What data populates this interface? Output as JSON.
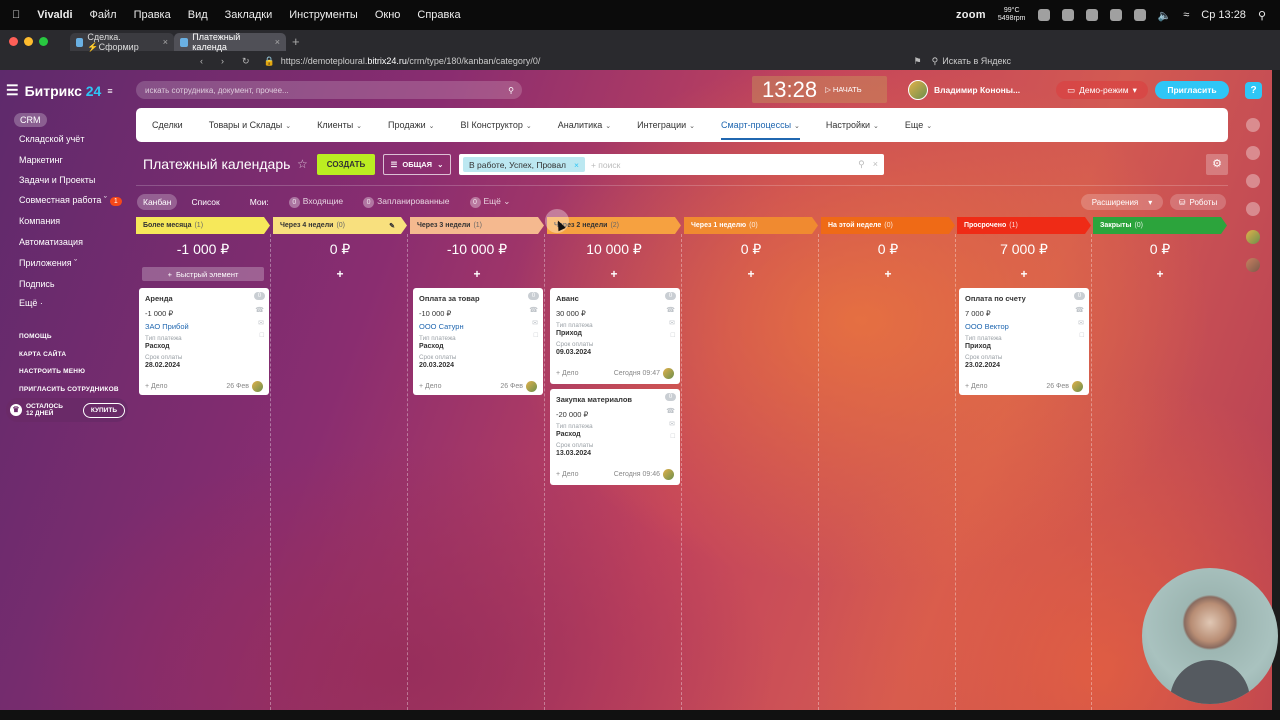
{
  "macos": {
    "app": "Vivaldi",
    "menu": [
      "Файл",
      "Правка",
      "Вид",
      "Закладки",
      "Инструменты",
      "Окно",
      "Справка"
    ],
    "zoom": "zoom",
    "temp": "99°C",
    "rpm": "5498rpm",
    "clock": "Ср 13:28"
  },
  "browser": {
    "tabs": [
      {
        "title": "Сделка. ⚡Сформир"
      },
      {
        "title": "Платежный календа"
      }
    ],
    "url_prefix": "https://demoteploural.",
    "url_domain": "bitrix24.ru",
    "url_path": "/crm/type/180/kanban/category/0/",
    "search_placeholder": "Искать в Яндекс"
  },
  "sidebar": {
    "logo_text": "Битрикс",
    "logo_num": "24",
    "items": [
      {
        "label": "CRM"
      },
      {
        "label": "Складской учёт"
      },
      {
        "label": "Маркетинг"
      },
      {
        "label": "Задачи и Проекты"
      },
      {
        "label": "Совместная работа",
        "badge": "1"
      },
      {
        "label": "Компания"
      },
      {
        "label": "Автоматизация"
      },
      {
        "label": "Приложения"
      },
      {
        "label": "Подпись"
      },
      {
        "label": "Ещё ·"
      }
    ],
    "links": [
      "ПОМОЩЬ",
      "КАРТА САЙТА",
      "НАСТРОИТЬ МЕНЮ",
      "ПРИГЛАСИТЬ СОТРУДНИКОВ"
    ],
    "trial_line1": "ОСТАЛОСЬ",
    "trial_line2": "12 ДНЕЙ",
    "buy": "КУПИТЬ"
  },
  "header": {
    "search_placeholder": "искать сотрудника, документ, прочее...",
    "time": "13:28",
    "start": "НАЧАТЬ",
    "user": "Владимир Кононы...",
    "demo": "Демо-режим",
    "invite": "Пригласить",
    "help": "?"
  },
  "menu": [
    {
      "label": "Сделки",
      "dropdown": false
    },
    {
      "label": "Товары и Склады",
      "dropdown": true
    },
    {
      "label": "Клиенты",
      "dropdown": true
    },
    {
      "label": "Продажи",
      "dropdown": true
    },
    {
      "label": "BI Конструктор",
      "dropdown": true
    },
    {
      "label": "Аналитика",
      "dropdown": true
    },
    {
      "label": "Интеграции",
      "dropdown": true
    },
    {
      "label": "Смарт-процессы",
      "dropdown": true,
      "active": true
    },
    {
      "label": "Настройки",
      "dropdown": true
    },
    {
      "label": "Еще",
      "dropdown": true
    }
  ],
  "toolbar": {
    "title": "Платежный календарь",
    "create": "СОЗДАТЬ",
    "general": "ОБЩАЯ",
    "filter_tag": "В работе, Успех, Провал",
    "filter_search": "+ поиск"
  },
  "views": {
    "kanban": "Канбан",
    "list": "Список",
    "mine": "Мои:",
    "incoming_count": "0",
    "incoming": "Входящие",
    "planned_count": "0",
    "planned": "Запланированные",
    "more_count": "0",
    "more": "Ещё",
    "extensions": "Расширения",
    "robots": "Роботы"
  },
  "kanban": {
    "quick_add": "Быстрый элемент",
    "columns": [
      {
        "title": "Более месяца",
        "count": "(1)",
        "sum": "-1 000 ₽",
        "color": "#f6e85a"
      },
      {
        "title": "Через 4 недели",
        "count": "(0)",
        "sum": "0 ₽",
        "color": "#f8e07e"
      },
      {
        "title": "Через 3 недели",
        "count": "(1)",
        "sum": "-10 000 ₽",
        "color": "#f5b98f"
      },
      {
        "title": "Через 2 недели",
        "count": "(2)",
        "sum": "10 000 ₽",
        "color": "#f6a140"
      },
      {
        "title": "Через 1 неделю",
        "count": "(0)",
        "sum": "0 ₽",
        "color": "#f08a30"
      },
      {
        "title": "На этой неделе",
        "count": "(0)",
        "sum": "0 ₽",
        "color": "#ef6a16"
      },
      {
        "title": "Просрочено",
        "count": "(1)",
        "sum": "7 000 ₽",
        "color": "#ef2b16"
      },
      {
        "title": "Закрыты",
        "count": "(0)",
        "sum": "0 ₽",
        "color": "#2ca43c"
      }
    ],
    "card_labels": {
      "type": "Тип платежа",
      "due": "Срок оплаты",
      "task": "+ Дело",
      "zero": "0"
    },
    "cards": [
      {
        "title": "Аренда",
        "amount": "-1 000 ₽",
        "company": "ЗАО Прибой",
        "type": "Расход",
        "due": "28.02.2024",
        "date": "26 Фев"
      },
      {
        "title": "Оплата за товар",
        "amount": "-10 000 ₽",
        "company": "ООО Сатурн",
        "type": "Расход",
        "due": "20.03.2024",
        "date": "26 Фев"
      },
      {
        "title": "Аванс",
        "amount": "30 000 ₽",
        "company": "",
        "type": "Приход",
        "due": "09.03.2024",
        "date": "Сегодня 09:47"
      },
      {
        "title": "Закупка материалов",
        "amount": "-20 000 ₽",
        "company": "",
        "type": "Расход",
        "due": "13.03.2024",
        "date": "Сегодня 09:46"
      },
      {
        "title": "Оплата по счету",
        "amount": "7 000 ₽",
        "company": "ООО Вектор",
        "type": "Приход",
        "due": "23.02.2024",
        "date": "26 Фев"
      }
    ]
  }
}
